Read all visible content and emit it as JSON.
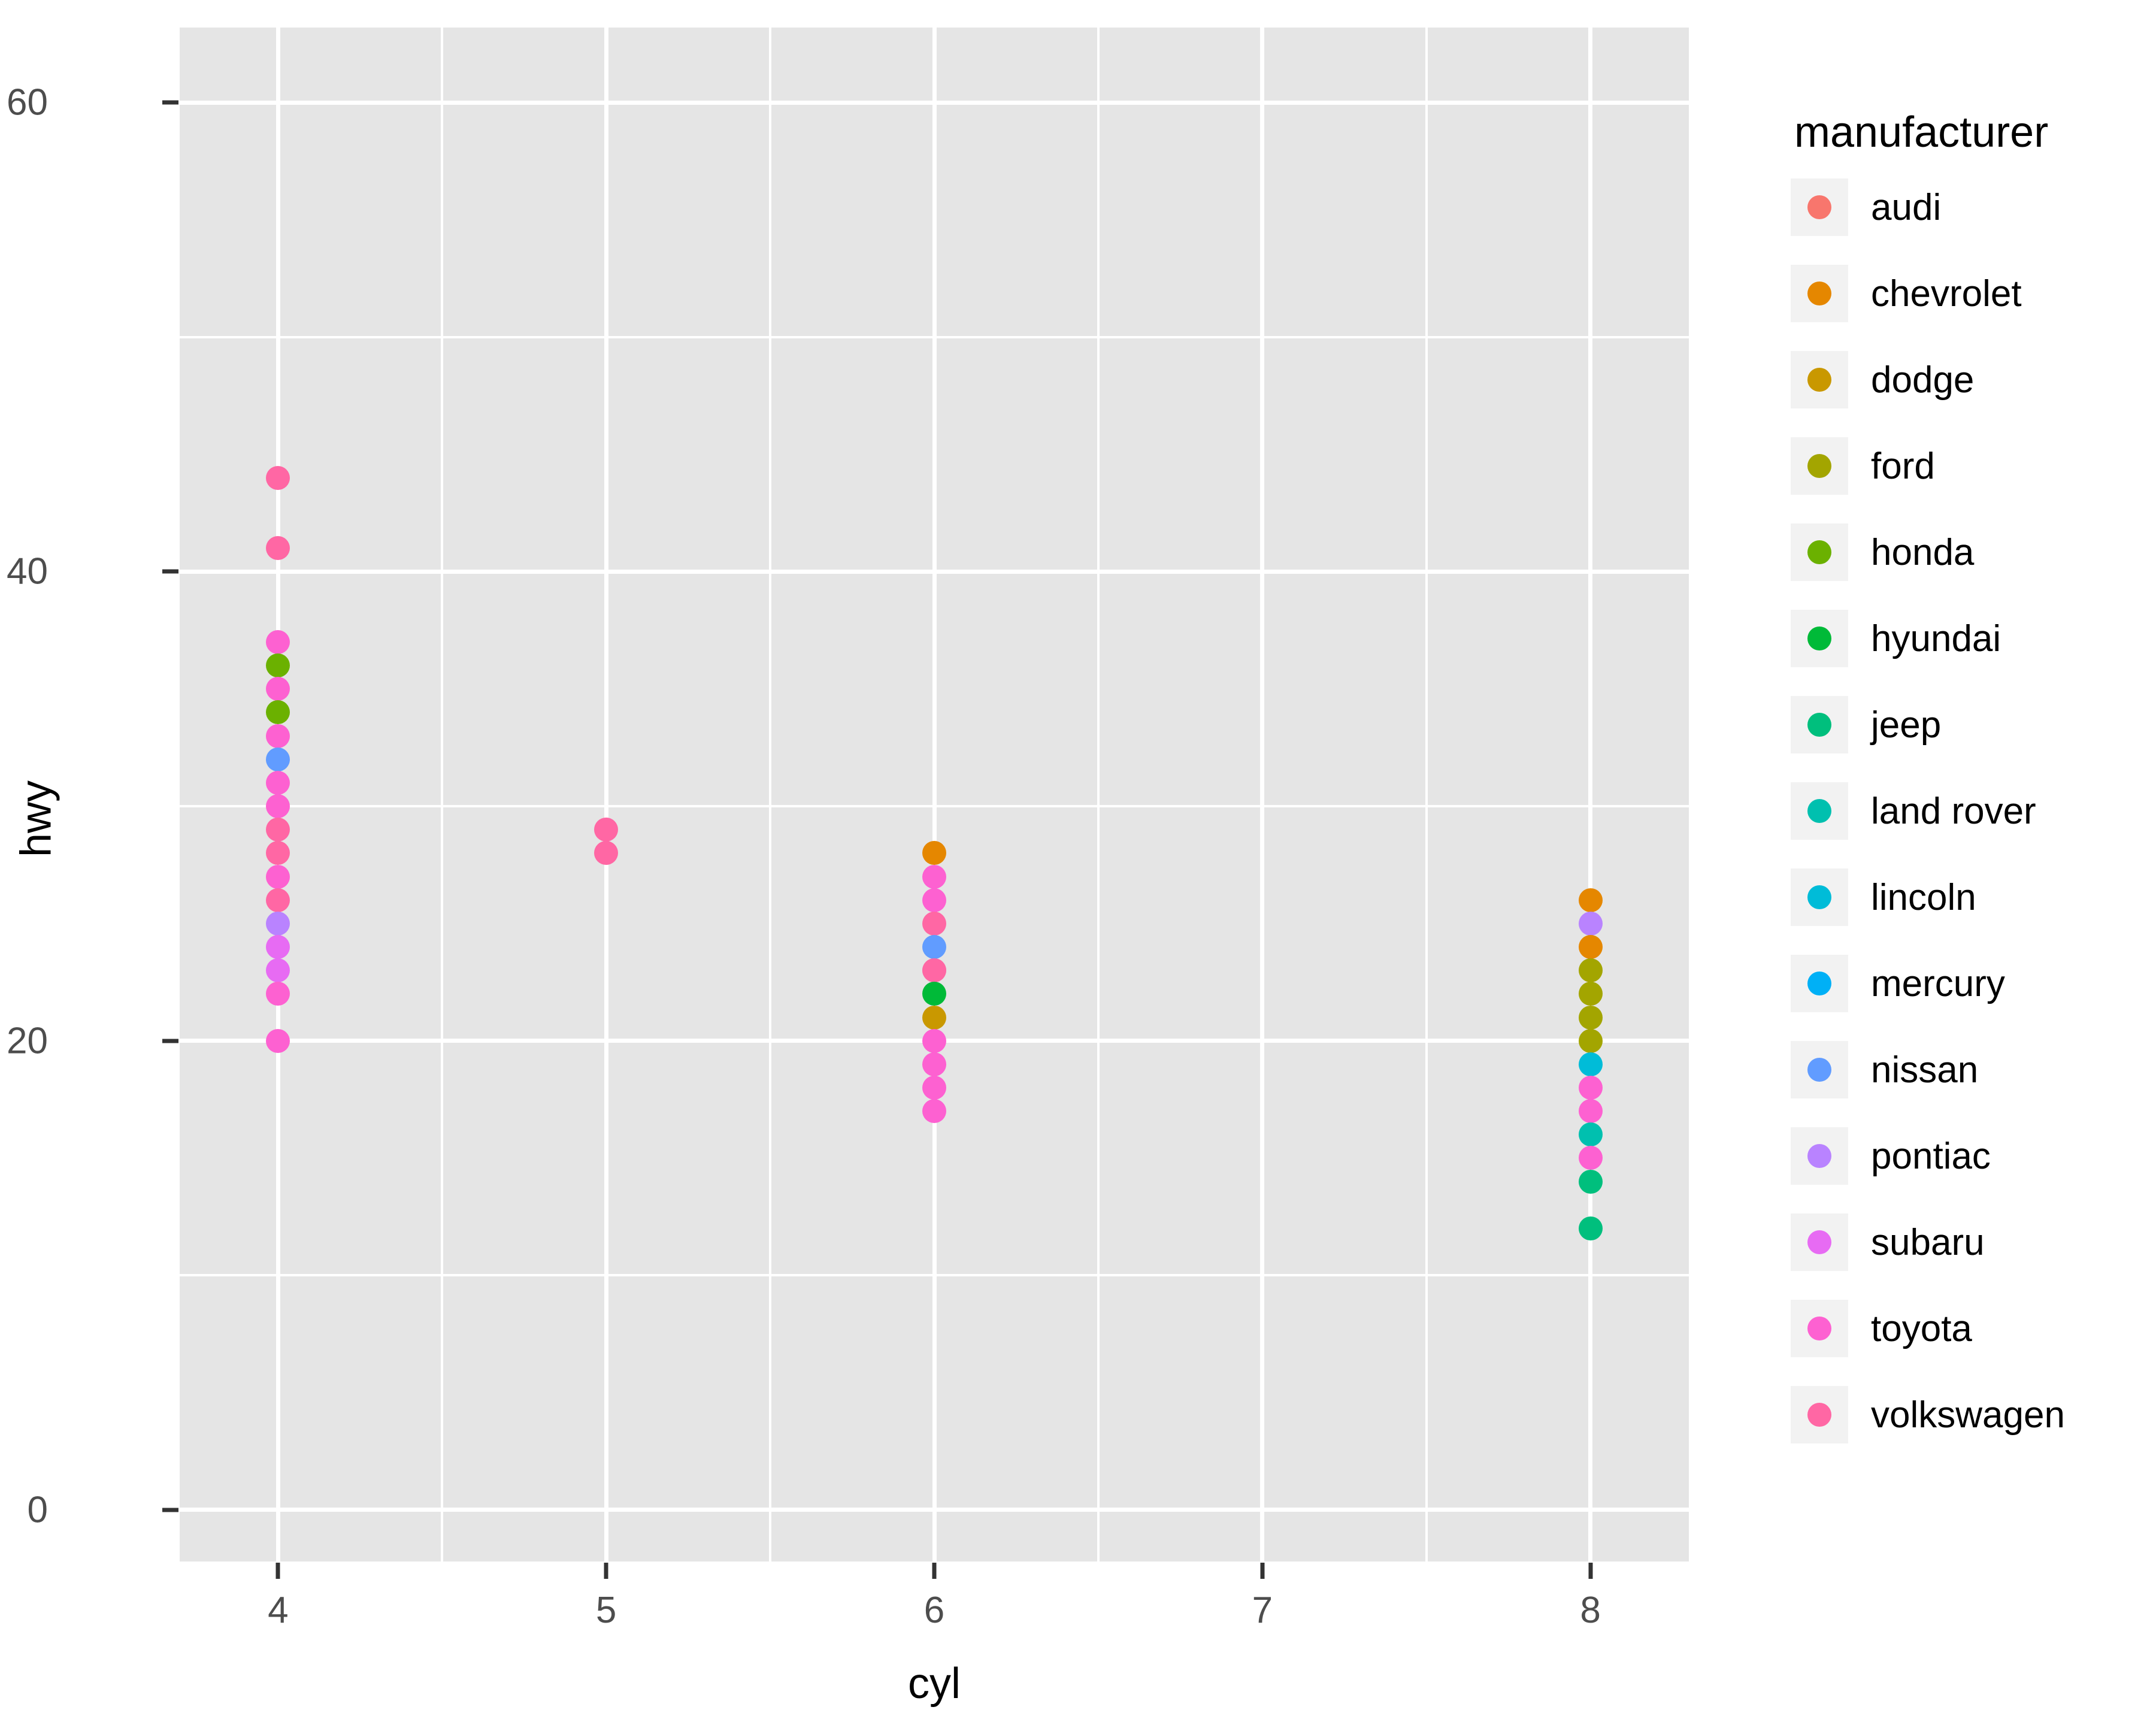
{
  "chart_data": {
    "type": "scatter",
    "title": "",
    "xlabel": "cyl",
    "ylabel": "hwy",
    "xlim": [
      3.7,
      8.3
    ],
    "ylim": [
      -2.2,
      63.2
    ],
    "x_ticks": [
      "4",
      "5",
      "6",
      "7",
      "8"
    ],
    "x_tick_values": [
      4,
      5,
      6,
      7,
      8
    ],
    "y_ticks": [
      "0",
      "20",
      "40",
      "60"
    ],
    "y_tick_values": [
      0,
      20,
      40,
      60
    ],
    "grid": true,
    "legend": {
      "title": "manufacturer",
      "position": "right",
      "entries": [
        {
          "label": "audi",
          "color": "#F8766D"
        },
        {
          "label": "chevrolet",
          "color": "#E58700"
        },
        {
          "label": "dodge",
          "color": "#C99800"
        },
        {
          "label": "ford",
          "color": "#A3A500"
        },
        {
          "label": "honda",
          "color": "#6BB100"
        },
        {
          "label": "hyundai",
          "color": "#00BA38"
        },
        {
          "label": "jeep",
          "color": "#00BF7D"
        },
        {
          "label": "land rover",
          "color": "#00C0AF"
        },
        {
          "label": "lincoln",
          "color": "#00BCD8"
        },
        {
          "label": "mercury",
          "color": "#00B0F6"
        },
        {
          "label": "nissan",
          "color": "#619CFF"
        },
        {
          "label": "pontiac",
          "color": "#B983FF"
        },
        {
          "label": "subaru",
          "color": "#E76BF3"
        },
        {
          "label": "toyota",
          "color": "#FD61D1"
        },
        {
          "label": "volkswagen",
          "color": "#FF67A4"
        }
      ]
    },
    "series": [
      {
        "name": "audi",
        "color": "#F8766D",
        "points": []
      },
      {
        "name": "chevrolet",
        "color": "#E58700",
        "points": [
          [
            6,
            28
          ],
          [
            8,
            26
          ],
          [
            8,
            24
          ]
        ]
      },
      {
        "name": "dodge",
        "color": "#C99800",
        "points": [
          [
            6,
            21
          ]
        ]
      },
      {
        "name": "ford",
        "color": "#A3A500",
        "points": [
          [
            8,
            23
          ],
          [
            8,
            22
          ],
          [
            8,
            21
          ],
          [
            8,
            20
          ]
        ]
      },
      {
        "name": "honda",
        "color": "#6BB100",
        "points": [
          [
            4,
            36
          ],
          [
            4,
            34
          ]
        ]
      },
      {
        "name": "hyundai",
        "color": "#00BA38",
        "points": [
          [
            6,
            22
          ]
        ]
      },
      {
        "name": "jeep",
        "color": "#00BF7D",
        "points": [
          [
            8,
            15
          ],
          [
            8,
            13
          ]
        ]
      },
      {
        "name": "land rover",
        "color": "#00C0AF",
        "points": [
          [
            8,
            16
          ]
        ]
      },
      {
        "name": "lincoln",
        "color": "#00BCD8",
        "points": [
          [
            8,
            19
          ]
        ]
      },
      {
        "name": "mercury",
        "color": "#00B0F6",
        "points": []
      },
      {
        "name": "nissan",
        "color": "#619CFF",
        "points": [
          [
            4,
            32
          ],
          [
            6,
            25
          ]
        ]
      },
      {
        "name": "pontiac",
        "color": "#B983FF",
        "points": [
          [
            4,
            25
          ],
          [
            4,
            24
          ],
          [
            4,
            23
          ],
          [
            8,
            25
          ]
        ]
      },
      {
        "name": "subaru",
        "color": "#E76BF3",
        "points": [
          [
            4,
            37
          ],
          [
            4,
            35
          ],
          [
            4,
            33
          ],
          [
            4,
            31
          ],
          [
            4,
            30
          ],
          [
            4,
            27
          ],
          [
            4,
            26
          ],
          [
            4,
            22
          ],
          [
            4,
            20
          ],
          [
            6,
            27
          ],
          [
            6,
            26
          ],
          [
            6,
            20
          ],
          [
            6,
            19
          ],
          [
            6,
            18
          ],
          [
            6,
            17
          ],
          [
            8,
            18
          ],
          [
            8,
            17
          ],
          [
            8,
            15
          ]
        ]
      },
      {
        "name": "toyota",
        "color": "#FD61D1",
        "points": [
          [
            4,
            29
          ],
          [
            4,
            28
          ]
        ]
      },
      {
        "name": "volkswagen",
        "color": "#FF67A4",
        "points": [
          [
            4,
            44
          ],
          [
            4,
            41
          ],
          [
            5,
            29
          ],
          [
            5,
            28
          ],
          [
            6,
            26
          ],
          [
            6,
            24
          ],
          [
            6,
            23
          ]
        ]
      }
    ],
    "points": [
      {
        "cyl": 4,
        "hwy": 44,
        "manufacturer": "volkswagen",
        "color": "#FF67A4"
      },
      {
        "cyl": 4,
        "hwy": 41,
        "manufacturer": "volkswagen",
        "color": "#FF67A4"
      },
      {
        "cyl": 4,
        "hwy": 37,
        "manufacturer": "toyota",
        "color": "#FD61D1"
      },
      {
        "cyl": 4,
        "hwy": 36,
        "manufacturer": "honda",
        "color": "#6BB100"
      },
      {
        "cyl": 4,
        "hwy": 35,
        "manufacturer": "toyota",
        "color": "#FD61D1"
      },
      {
        "cyl": 4,
        "hwy": 34,
        "manufacturer": "honda",
        "color": "#6BB100"
      },
      {
        "cyl": 4,
        "hwy": 33,
        "manufacturer": "toyota",
        "color": "#FD61D1"
      },
      {
        "cyl": 4,
        "hwy": 32,
        "manufacturer": "nissan",
        "color": "#619CFF"
      },
      {
        "cyl": 4,
        "hwy": 31,
        "manufacturer": "toyota",
        "color": "#FD61D1"
      },
      {
        "cyl": 4,
        "hwy": 30,
        "manufacturer": "toyota",
        "color": "#FD61D1"
      },
      {
        "cyl": 4,
        "hwy": 29,
        "manufacturer": "volkswagen",
        "color": "#FF67A4"
      },
      {
        "cyl": 4,
        "hwy": 28,
        "manufacturer": "volkswagen",
        "color": "#FF67A4"
      },
      {
        "cyl": 4,
        "hwy": 27,
        "manufacturer": "toyota",
        "color": "#FD61D1"
      },
      {
        "cyl": 4,
        "hwy": 26,
        "manufacturer": "volkswagen",
        "color": "#FF67A4"
      },
      {
        "cyl": 4,
        "hwy": 25,
        "manufacturer": "pontiac",
        "color": "#B983FF"
      },
      {
        "cyl": 4,
        "hwy": 24,
        "manufacturer": "subaru",
        "color": "#E76BF3"
      },
      {
        "cyl": 4,
        "hwy": 23,
        "manufacturer": "subaru",
        "color": "#E76BF3"
      },
      {
        "cyl": 4,
        "hwy": 22,
        "manufacturer": "toyota",
        "color": "#FD61D1"
      },
      {
        "cyl": 4,
        "hwy": 20,
        "manufacturer": "toyota",
        "color": "#FD61D1"
      },
      {
        "cyl": 5,
        "hwy": 29,
        "manufacturer": "volkswagen",
        "color": "#FF67A4"
      },
      {
        "cyl": 5,
        "hwy": 28,
        "manufacturer": "volkswagen",
        "color": "#FF67A4"
      },
      {
        "cyl": 6,
        "hwy": 28,
        "manufacturer": "chevrolet",
        "color": "#E58700"
      },
      {
        "cyl": 6,
        "hwy": 27,
        "manufacturer": "toyota",
        "color": "#FD61D1"
      },
      {
        "cyl": 6,
        "hwy": 26,
        "manufacturer": "toyota",
        "color": "#FD61D1"
      },
      {
        "cyl": 6,
        "hwy": 25,
        "manufacturer": "volkswagen",
        "color": "#FF67A4"
      },
      {
        "cyl": 6,
        "hwy": 24,
        "manufacturer": "nissan",
        "color": "#619CFF"
      },
      {
        "cyl": 6,
        "hwy": 23,
        "manufacturer": "volkswagen",
        "color": "#FF67A4"
      },
      {
        "cyl": 6,
        "hwy": 23,
        "manufacturer": "volkswagen",
        "color": "#FF67A4"
      },
      {
        "cyl": 6,
        "hwy": 22,
        "manufacturer": "hyundai",
        "color": "#00BA38"
      },
      {
        "cyl": 6,
        "hwy": 21,
        "manufacturer": "dodge",
        "color": "#C99800"
      },
      {
        "cyl": 6,
        "hwy": 20,
        "manufacturer": "toyota",
        "color": "#FD61D1"
      },
      {
        "cyl": 6,
        "hwy": 19,
        "manufacturer": "toyota",
        "color": "#FD61D1"
      },
      {
        "cyl": 6,
        "hwy": 18,
        "manufacturer": "toyota",
        "color": "#FD61D1"
      },
      {
        "cyl": 6,
        "hwy": 17,
        "manufacturer": "toyota",
        "color": "#FD61D1"
      },
      {
        "cyl": 8,
        "hwy": 26,
        "manufacturer": "chevrolet",
        "color": "#E58700"
      },
      {
        "cyl": 8,
        "hwy": 25,
        "manufacturer": "pontiac",
        "color": "#B983FF"
      },
      {
        "cyl": 8,
        "hwy": 24,
        "manufacturer": "chevrolet",
        "color": "#E58700"
      },
      {
        "cyl": 8,
        "hwy": 23,
        "manufacturer": "ford",
        "color": "#A3A500"
      },
      {
        "cyl": 8,
        "hwy": 22,
        "manufacturer": "ford",
        "color": "#A3A500"
      },
      {
        "cyl": 8,
        "hwy": 21,
        "manufacturer": "ford",
        "color": "#A3A500"
      },
      {
        "cyl": 8,
        "hwy": 20,
        "manufacturer": "ford",
        "color": "#A3A500"
      },
      {
        "cyl": 8,
        "hwy": 19,
        "manufacturer": "lincoln",
        "color": "#00BCD8"
      },
      {
        "cyl": 8,
        "hwy": 18,
        "manufacturer": "toyota",
        "color": "#FD61D1"
      },
      {
        "cyl": 8,
        "hwy": 17,
        "manufacturer": "toyota",
        "color": "#FD61D1"
      },
      {
        "cyl": 8,
        "hwy": 16,
        "manufacturer": "land rover",
        "color": "#00C0AF"
      },
      {
        "cyl": 8,
        "hwy": 15,
        "manufacturer": "toyota",
        "color": "#FD61D1"
      },
      {
        "cyl": 8,
        "hwy": 14,
        "manufacturer": "jeep",
        "color": "#00BF7D"
      },
      {
        "cyl": 8,
        "hwy": 12,
        "manufacturer": "jeep",
        "color": "#00BF7D"
      }
    ]
  },
  "theme": {
    "panel_background": "#e5e5e5",
    "gridline_color": "#ffffff",
    "legend_key_background": "#f2f2f2",
    "axis_text_color": "#4d4d4d",
    "axis_title_color": "#000000"
  }
}
